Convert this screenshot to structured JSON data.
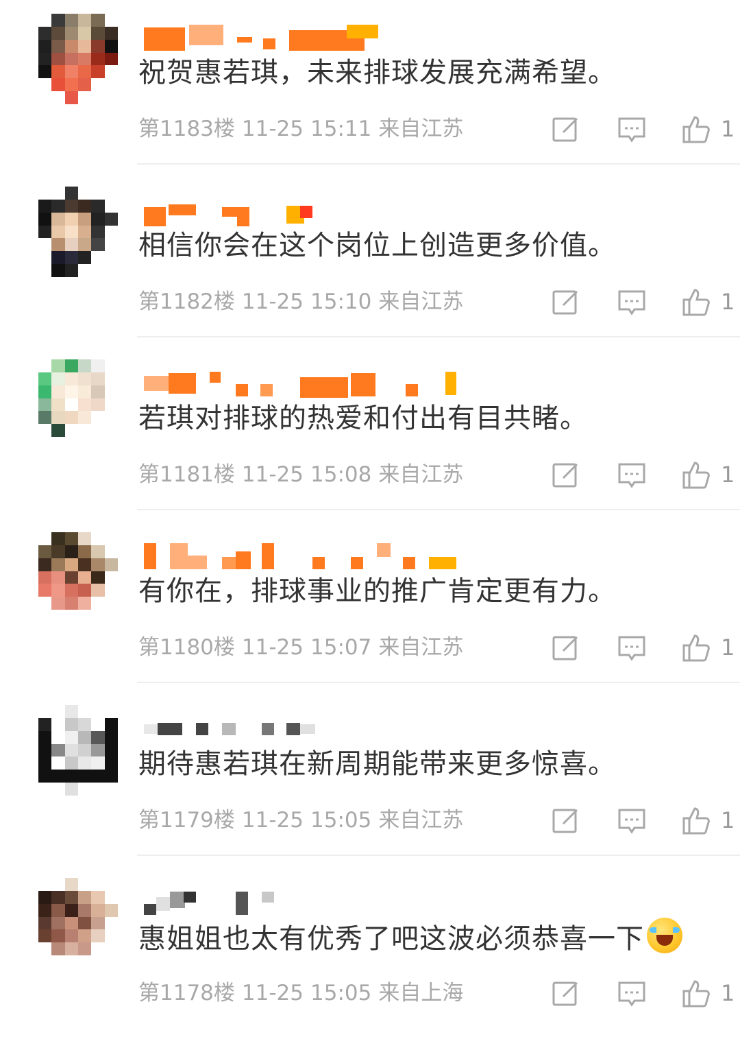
{
  "comments": [
    {
      "text": "祝贺惠若琪，未来排球发展充满希望。",
      "floor": "第1183楼",
      "date": "11-25",
      "time": "15:11",
      "location": "来自江苏",
      "like_count": "1"
    },
    {
      "text": "相信你会在这个岗位上创造更多价值。",
      "floor": "第1182楼",
      "date": "11-25",
      "time": "15:10",
      "location": "来自江苏",
      "like_count": "1"
    },
    {
      "text": "若琪对排球的热爱和付出有目共睹。",
      "floor": "第1181楼",
      "date": "11-25",
      "time": "15:08",
      "location": "来自江苏",
      "like_count": "1"
    },
    {
      "text": "有你在，排球事业的推广肯定更有力。",
      "floor": "第1180楼",
      "date": "11-25",
      "time": "15:07",
      "location": "来自江苏",
      "like_count": "1"
    },
    {
      "text": "期待惠若琪在新周期能带来更多惊喜。",
      "floor": "第1179楼",
      "date": "11-25",
      "time": "15:05",
      "location": "来自江苏",
      "like_count": "1"
    },
    {
      "text": "惠姐姐也太有优秀了吧这波必须恭喜一下",
      "floor": "第1178楼",
      "date": "11-25",
      "time": "15:05",
      "location": "来自上海",
      "like_count": "1",
      "emoji": "laughing-crying-emoji"
    }
  ],
  "icons": {
    "edit": "edit-icon",
    "reply": "comment-icon",
    "like": "thumbs-up-icon"
  },
  "colors": {
    "username_blur": "#ff7a1f",
    "meta_text": "#a8a8a8",
    "comment_text": "#333333"
  }
}
